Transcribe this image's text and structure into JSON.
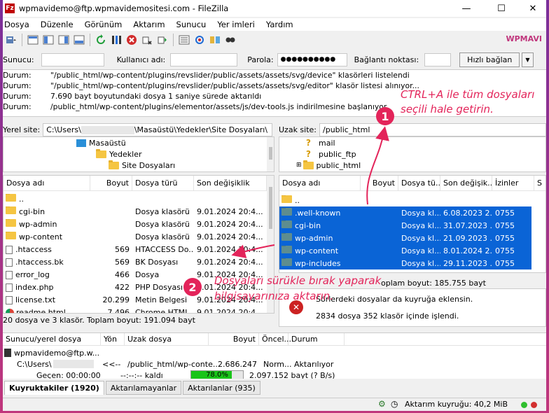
{
  "window": {
    "title": "wpmavidemo@ftp.wpmavidemositesi.com - FileZilla",
    "brand": "WPMAVI"
  },
  "menu": [
    "Dosya",
    "Düzenle",
    "Görünüm",
    "Aktarım",
    "Sunucu",
    "Yer imleri",
    "Yardım"
  ],
  "quickconnect": {
    "host_label": "Sunucu:",
    "user_label": "Kullanıcı adı:",
    "pass_label": "Parola:",
    "pass_value": "●●●●●●●●●●",
    "port_label": "Bağlantı noktası:",
    "connect_label": "Hızlı bağlan",
    "dropdown": "▼"
  },
  "log": [
    {
      "k": "Durum:",
      "v": "\"/public_html/wp-content/plugins/revslider/public/assets/assets/svg/device\" klasörleri listelendi"
    },
    {
      "k": "Durum:",
      "v": "\"/public_html/wp-content/plugins/revslider/public/assets/assets/svg/editor\" klasör listesi alınıyor..."
    },
    {
      "k": "Durum:",
      "v": "7.690 bayt boyutundaki dosya 1 saniye sürede aktarıldı"
    },
    {
      "k": "Durum:",
      "v": "/public_html/wp-content/plugins/elementor/assets/js/dev-tools.js indirilmesine başlanıyor"
    }
  ],
  "local": {
    "site_label": "Yerel site:",
    "site_path_a": "C:\\Users\\",
    "site_path_b": "\\Masaüstü\\Yedekler\\Site Dosyaları\\",
    "tree": [
      {
        "label": "Masaüstü"
      },
      {
        "label": "Yedekler"
      },
      {
        "label": "Site Dosyaları"
      }
    ],
    "columns": [
      "Dosya adı",
      "Boyut",
      "Dosya türü",
      "Son değişiklik"
    ],
    "rows": [
      {
        "name": "..",
        "size": "",
        "type": "",
        "date": "",
        "icon": "folder"
      },
      {
        "name": "cgi-bin",
        "size": "",
        "type": "Dosya klasörü",
        "date": "9.01.2024 20:4...",
        "icon": "folder"
      },
      {
        "name": "wp-admin",
        "size": "",
        "type": "Dosya klasörü",
        "date": "9.01.2024 20:4...",
        "icon": "folder"
      },
      {
        "name": "wp-content",
        "size": "",
        "type": "Dosya klasörü",
        "date": "9.01.2024 20:4...",
        "icon": "folder"
      },
      {
        "name": ".htaccess",
        "size": "569",
        "type": "HTACCESS Do...",
        "date": "9.01.2024 20:4...",
        "icon": "file"
      },
      {
        "name": ".htaccess.bk",
        "size": "569",
        "type": "BK Dosyası",
        "date": "9.01.2024 20:4...",
        "icon": "file"
      },
      {
        "name": "error_log",
        "size": "466",
        "type": "Dosya",
        "date": "9.01.2024 20:4...",
        "icon": "file"
      },
      {
        "name": "index.php",
        "size": "422",
        "type": "PHP Dosyası",
        "date": "9.01.2024 20:4...",
        "icon": "file"
      },
      {
        "name": "license.txt",
        "size": "20.299",
        "type": "Metin Belgesi",
        "date": "9.01.2024 20:4...",
        "icon": "file"
      },
      {
        "name": "readme.html",
        "size": "7.496",
        "type": "Chrome HTML ...",
        "date": "9.01.2024 20:4...",
        "icon": "chrome"
      }
    ],
    "status": "20 dosya ve 3 klasör. Toplam boyut: 191.094 bayt"
  },
  "remote": {
    "site_label": "Uzak site:",
    "site_path": "/public_html",
    "tree": [
      {
        "label": "mail",
        "icon": "q"
      },
      {
        "label": "public_ftp",
        "icon": "q"
      },
      {
        "label": "public_html",
        "icon": "folder"
      }
    ],
    "columns": [
      "Dosya adı",
      "Boyut",
      "Dosya tü...",
      "Son değişik...",
      "İzinler",
      "S"
    ],
    "rows": [
      {
        "name": "..",
        "size": "",
        "type": "",
        "date": "",
        "perm": "",
        "sel": false
      },
      {
        "name": ".well-known",
        "size": "",
        "type": "Dosya kl...",
        "date": "6.08.2023 2...",
        "perm": "0755",
        "sel": true
      },
      {
        "name": "cgi-bin",
        "size": "",
        "type": "Dosya kl...",
        "date": "31.07.2023 ...",
        "perm": "0755",
        "sel": true
      },
      {
        "name": "wp-admin",
        "size": "",
        "type": "Dosya kl...",
        "date": "21.09.2023 ...",
        "perm": "0755",
        "sel": true
      },
      {
        "name": "wp-content",
        "size": "",
        "type": "Dosya kl...",
        "date": "8.01.2024 2...",
        "perm": "0755",
        "sel": true
      },
      {
        "name": "wp-includes",
        "size": "",
        "type": "Dosya kl...",
        "date": "29.11.2023 ...",
        "perm": "0755",
        "sel": true
      }
    ],
    "status": "oplam boyut: 185.755 bayt",
    "msg1": "Sörlerdeki dosyalar da kuyruğa eklensin.",
    "msg2": "2834 dosya 352 klasör içinde işlendi."
  },
  "queue": {
    "columns": [
      "Sunucu/yerel dosya",
      "Yön",
      "Uzak dosya",
      "Boyut",
      "Öncel...",
      "Durum"
    ],
    "server": "wpmavidemo@ftp.w...",
    "local_file": "C:\\Users\\",
    "direction": "<<--",
    "remote_file": "/public_html/wp-conte...",
    "size": "2.686.247",
    "priority": "Norm...",
    "state": "Aktarılıyor",
    "elapsed": "Geçen: 00:00:00",
    "left": "--:--:-- kaldı",
    "progress_pct": 78.0,
    "progress_label": "78.0%",
    "bytes": "2.097.152 bayt (? B/s)"
  },
  "tabs": [
    "Kuyruktakiler (1920)",
    "Aktarılamayanlar",
    "Aktarılanlar (935)"
  ],
  "statusbar": {
    "queue": "Aktarım kuyruğu: 40,2 MiB"
  },
  "callouts": {
    "c1_num": "1",
    "c1_line1": "CTRL+A ile tüm dosyaları",
    "c1_line2": "seçili hale getirin.",
    "c2_num": "2",
    "c2_line1": "Dosyaları sürükle bırak yaparak",
    "c2_line2": "bilgisayarınıza aktarın."
  },
  "colors": {
    "accent": "#e3245a",
    "selection": "#0a64d6",
    "progress": "#18c418"
  }
}
